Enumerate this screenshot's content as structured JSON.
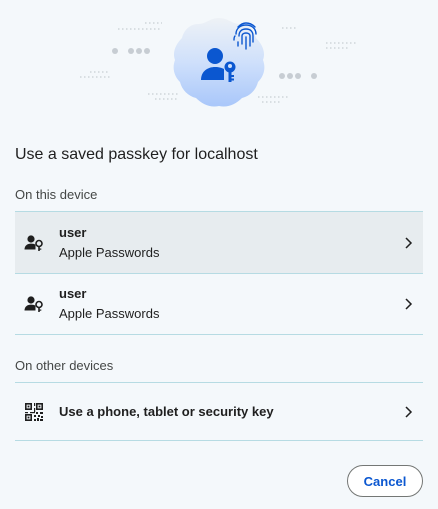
{
  "dialog": {
    "title": "Use a saved passkey for localhost",
    "sections": [
      {
        "label": "On this device",
        "items": [
          {
            "icon": "person-key-icon",
            "primary": "user",
            "secondary": "Apple Passwords",
            "hovered": true
          },
          {
            "icon": "person-key-icon",
            "primary": "user",
            "secondary": "Apple Passwords",
            "hovered": false
          }
        ]
      },
      {
        "label": "On other devices",
        "items": [
          {
            "icon": "qr-code-icon",
            "primary": "Use a phone, tablet or security key"
          }
        ]
      }
    ],
    "cancel_label": "Cancel"
  },
  "hero": {
    "icons": [
      "person-key-icon",
      "fingerprint-icon"
    ]
  },
  "colors": {
    "background": "#f4f8fb",
    "accent": "#0b57d0",
    "divider": "#b6dbe3",
    "hover_row": "#e7ecef"
  }
}
